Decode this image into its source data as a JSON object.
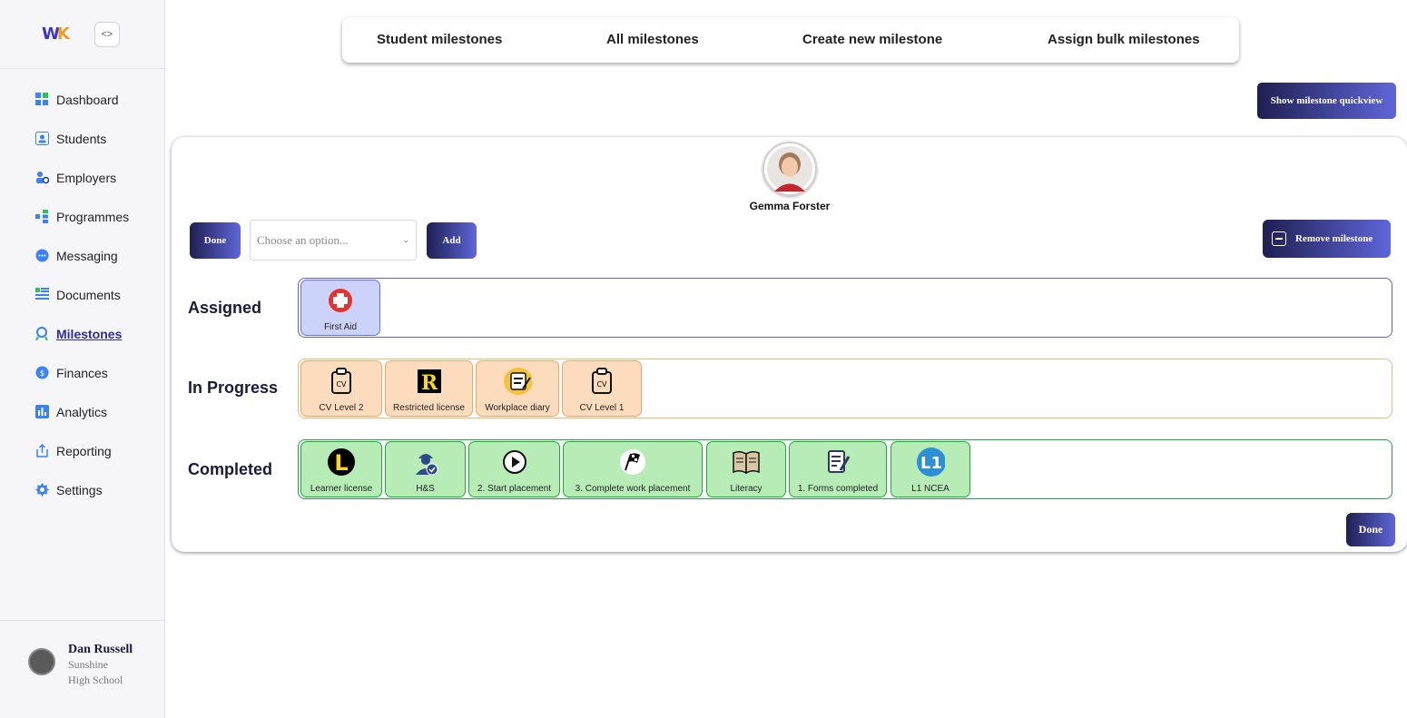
{
  "sidebar": {
    "items": [
      {
        "label": "Dashboard",
        "icon": "dashboard-icon",
        "color": "#3b82f6"
      },
      {
        "label": "Students",
        "icon": "students-icon",
        "color": "#3b82f6"
      },
      {
        "label": "Employers",
        "icon": "employers-icon",
        "color": "#3b82f6"
      },
      {
        "label": "Programmes",
        "icon": "programmes-icon",
        "color": "#3b82f6"
      },
      {
        "label": "Messaging",
        "icon": "messaging-icon",
        "color": "#3b82f6"
      },
      {
        "label": "Documents",
        "icon": "documents-icon",
        "color": "#3b82f6"
      },
      {
        "label": "Milestones",
        "icon": "milestones-icon",
        "color": "#3b82f6",
        "active": true
      },
      {
        "label": "Finances",
        "icon": "finances-icon",
        "color": "#3b82f6"
      },
      {
        "label": "Analytics",
        "icon": "analytics-icon",
        "color": "#3b82f6"
      },
      {
        "label": "Reporting",
        "icon": "reporting-icon",
        "color": "#3b82f6"
      },
      {
        "label": "Settings",
        "icon": "settings-icon",
        "color": "#3b82f6"
      }
    ],
    "user": {
      "name": "Dan Russell",
      "school": "Sunshine High School"
    }
  },
  "tabs": [
    "Student milestones",
    "All milestones",
    "Create new milestone",
    "Assign bulk milestones"
  ],
  "quickview_button": "Show milestone quickview",
  "student": {
    "name": "Gemma Forster"
  },
  "controls": {
    "done_label": "Done",
    "select_placeholder": "Choose an option...",
    "add_label": "Add",
    "remove_label": "Remove milestone",
    "done_bottom_label": "Done"
  },
  "lanes": {
    "assigned": {
      "label": "Assigned",
      "chips": [
        "First Aid"
      ]
    },
    "in_progress": {
      "label": "In Progress",
      "chips": [
        "CV Level 2",
        "Restricted license",
        "Workplace diary",
        "CV Level 1"
      ]
    },
    "completed": {
      "label": "Completed",
      "chips": [
        "Learner license",
        "H&S",
        "2. Start placement",
        "3. Complete work placement",
        "Literacy",
        "1. Forms completed",
        "L1 NCEA"
      ]
    }
  },
  "colors": {
    "accent_dark": "#1f1f52",
    "accent_light": "#5f66d8",
    "assigned_border": "#5f63c9",
    "progress_border": "#f2b779",
    "completed_border": "#1fa839"
  }
}
